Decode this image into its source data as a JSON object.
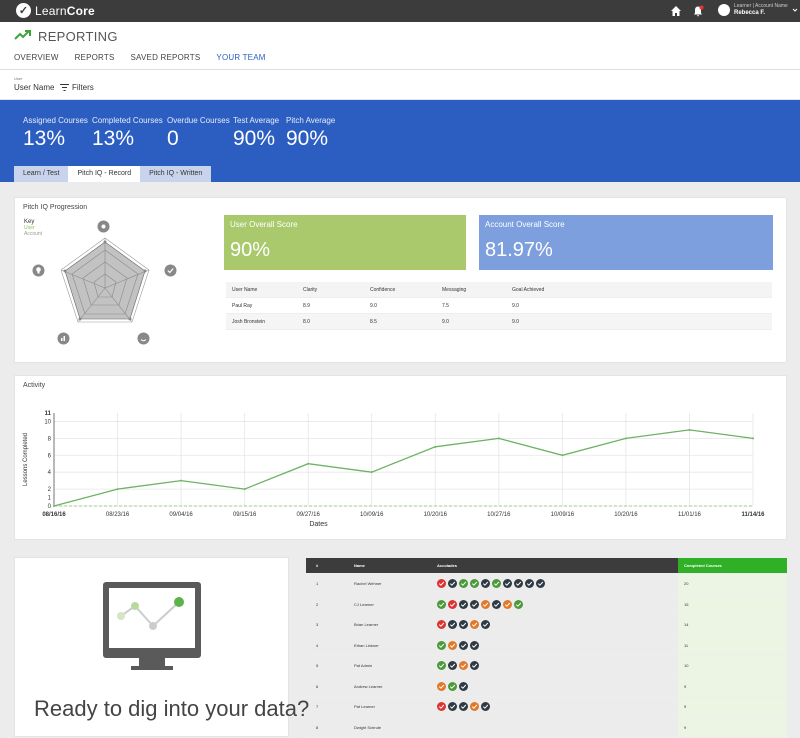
{
  "app": {
    "brand_a": "Learn",
    "brand_b": "Core",
    "logo_glyph": "✓"
  },
  "user": {
    "label": "Learner | Account Name",
    "name": "Rebecca F."
  },
  "page": {
    "title": "REPORTING"
  },
  "tabs": [
    {
      "label": "OVERVIEW",
      "active": false
    },
    {
      "label": "REPORTS",
      "active": false
    },
    {
      "label": "SAVED REPORTS",
      "active": false
    },
    {
      "label": "YOUR TEAM",
      "active": true
    }
  ],
  "filters": {
    "user_label": "User",
    "user_value": "User Name",
    "filters_label": "Filters"
  },
  "stats": [
    {
      "label": "Assigned Courses",
      "value": "13%"
    },
    {
      "label": "Completed Courses",
      "value": "13%"
    },
    {
      "label": "Overdue Courses",
      "value": "0"
    },
    {
      "label": "Test Average",
      "value": "90%"
    },
    {
      "label": "Pitch Average",
      "value": "90%"
    }
  ],
  "subtabs": [
    {
      "label": "Learn / Test",
      "active": false
    },
    {
      "label": "Pitch IQ - Record",
      "active": true
    },
    {
      "label": "Pitch IQ - Written",
      "active": false
    }
  ],
  "pitch": {
    "title": "Pitch IQ Progression",
    "key_label": "Key",
    "key_user": "User",
    "key_account": "Account",
    "user_score_title": "User Overall Score",
    "user_score": "90%",
    "account_score_title": "Account Overall Score",
    "account_score": "81.97%",
    "colors": {
      "user": "#a9c96c",
      "account": "#7d9fdd"
    },
    "table_headers": [
      "User Name",
      "Clarity",
      "Confidence",
      "Messaging",
      "Goal Achieved"
    ],
    "table_rows": [
      [
        "Paul Ray",
        "8.9",
        "9.0",
        "7.5",
        "9.0"
      ],
      [
        "Josh Bronstein",
        "8.0",
        "8.5",
        "9.0",
        "9.0"
      ]
    ]
  },
  "activity": {
    "title": "Activity",
    "chart_data": {
      "type": "line",
      "x": [
        "08/16/16",
        "08/23/16",
        "09/04/16",
        "09/15/16",
        "09/27/16",
        "10/09/16",
        "10/20/16",
        "10/27/16",
        "10/09/16",
        "10/20/16",
        "11/01/16",
        "11/14/16"
      ],
      "y": [
        0,
        2,
        3,
        2,
        5,
        4,
        7,
        8,
        6,
        8,
        9,
        8
      ],
      "ylim": [
        0,
        11
      ],
      "yticks": [
        "0",
        "1",
        "2",
        "3",
        "4",
        "5",
        "6",
        "7",
        "8",
        "9",
        "10",
        "11"
      ],
      "xlabel": "Dates",
      "ylabel": "Lessons Completed",
      "color": "#6db364"
    }
  },
  "cta": {
    "text": "Ready to dig into your data?"
  },
  "leaderboard": {
    "headers": [
      "#",
      "Name",
      "Accolades",
      "Completed Courses"
    ],
    "rows": [
      {
        "rank": "1",
        "name": "Rachel Wehner",
        "badges": [
          "red",
          "dark",
          "green",
          "green",
          "dark",
          "green",
          "dark",
          "dark",
          "dark",
          "dark"
        ],
        "completed": "20"
      },
      {
        "rank": "2",
        "name": "CJ Learner",
        "badges": [
          "green",
          "red",
          "dark",
          "dark",
          "orange",
          "dark",
          "orange",
          "green"
        ],
        "completed": "15"
      },
      {
        "rank": "3",
        "name": "Brian Learner",
        "badges": [
          "red",
          "dark",
          "dark",
          "orange",
          "dark"
        ],
        "completed": "14"
      },
      {
        "rank": "4",
        "name": "Ethan Linkner",
        "badges": [
          "green",
          "orange",
          "dark",
          "dark"
        ],
        "completed": "11"
      },
      {
        "rank": "5",
        "name": "Pat Admin",
        "badges": [
          "green",
          "dark",
          "orange",
          "dark"
        ],
        "completed": "10"
      },
      {
        "rank": "6",
        "name": "Andrew Learner",
        "badges": [
          "orange",
          "green",
          "dark"
        ],
        "completed": "9"
      },
      {
        "rank": "7",
        "name": "Pat Learner",
        "badges": [
          "red",
          "dark",
          "dark",
          "orange",
          "dark"
        ],
        "completed": "9"
      },
      {
        "rank": "8",
        "name": "Dwight Schrute",
        "badges": [],
        "completed": "9"
      }
    ]
  }
}
